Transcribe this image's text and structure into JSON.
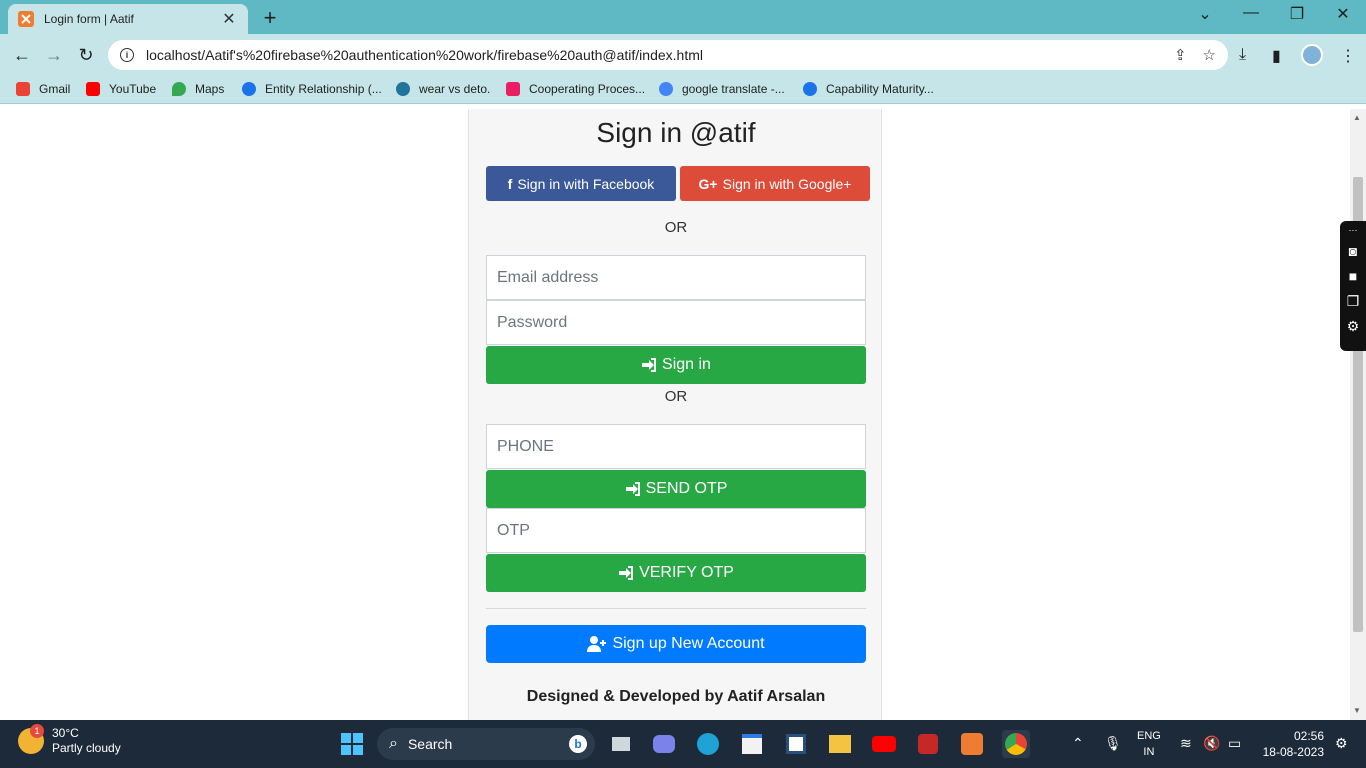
{
  "browser": {
    "tab_title": "Login form | Aatif",
    "url": "localhost/Aatif's%20firebase%20authentication%20work/firebase%20auth@atif/index.html",
    "bookmarks": [
      {
        "label": "Gmail",
        "icon": "gmail-icon",
        "color": "#ea4335"
      },
      {
        "label": "YouTube",
        "icon": "youtube-icon",
        "color": "#ff0000"
      },
      {
        "label": "Maps",
        "icon": "maps-icon",
        "color": "#34a853"
      },
      {
        "label": "Entity Relationship (...",
        "icon": "globe-icon",
        "color": "#1a73e8"
      },
      {
        "label": "wear vs deto.",
        "icon": "wordpress-icon",
        "color": "#21759b"
      },
      {
        "label": "Cooperating Proces...",
        "icon": "cube-icon",
        "color": "#e91e63"
      },
      {
        "label": "google translate -...",
        "icon": "google-icon",
        "color": "#4285f4"
      },
      {
        "label": "Capability Maturity...",
        "icon": "globe-icon",
        "color": "#1a73e8"
      }
    ]
  },
  "page": {
    "heading": "Sign in @atif",
    "facebook_label": "Sign in with Facebook",
    "google_label": "Sign in with Google+",
    "or_1": "OR",
    "email_placeholder": "Email address",
    "password_placeholder": "Password",
    "signin_label": "Sign in",
    "or_2": "OR",
    "phone_placeholder": "PHONE",
    "send_otp_label": "SEND OTP",
    "otp_placeholder": "OTP",
    "verify_otp_label": "VERIFY OTP",
    "signup_label": "Sign up New Account",
    "footer": "Designed & Developed by Aatif Arsalan"
  },
  "colors": {
    "facebook": "#3b5998",
    "google": "#dd4b39",
    "success": "#28a745",
    "primary": "#007bff"
  },
  "taskbar": {
    "temperature": "30°C",
    "weather": "Partly cloudy",
    "weather_badge": "1",
    "search_label": "Search",
    "language_1": "ENG",
    "language_2": "IN",
    "time": "02:56",
    "date": "18-08-2023"
  }
}
